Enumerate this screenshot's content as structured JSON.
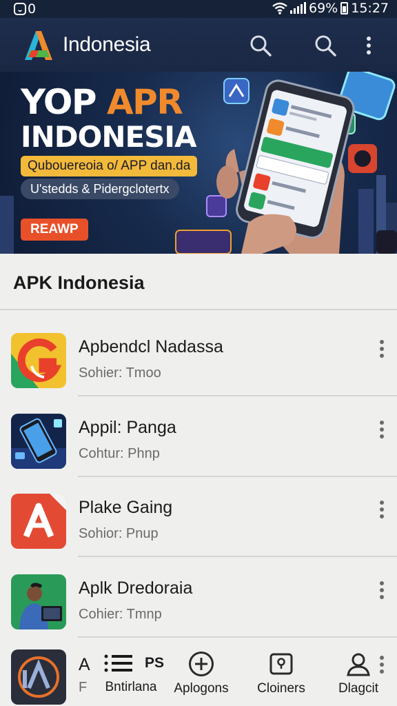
{
  "status_bar": {
    "left_text": "0",
    "battery": "69%",
    "time": "15:27"
  },
  "app_bar": {
    "title": "Indonesia"
  },
  "banner": {
    "headline_1": "YOP ",
    "headline_accent": "APR",
    "headline_2": "INDONESIA",
    "tagline": "Qubouereoia o/ APP dan.da",
    "subtitle": "U'stedds & Pidergclotertx",
    "cta": "REAWP"
  },
  "section": {
    "title": "APK Indonesia"
  },
  "apps": [
    {
      "name": "Apbendcl Nadassa",
      "subtitle": "Sohier: Tmoo",
      "icon": "green-g-phone-icon"
    },
    {
      "name": "Appil: Panga",
      "subtitle": "Cohtur: Phnp",
      "icon": "smartphone-icon"
    },
    {
      "name": "Plake Gaing",
      "subtitle": "Sohior: Pnup",
      "icon": "letter-a-icon"
    },
    {
      "name": "Aplk Dredoraia",
      "subtitle": "Cohier: Tmnp",
      "icon": "person-laptop-icon"
    },
    {
      "name": "A",
      "subtitle": "F",
      "icon": "ia-logo-icon"
    }
  ],
  "bottom_nav": [
    {
      "label": "Bntirlana",
      "extra": "PS",
      "icon": "list-icon"
    },
    {
      "label": "Aplogons",
      "icon": "add-circle-icon"
    },
    {
      "label": "Cloiners",
      "icon": "question-card-icon"
    },
    {
      "label": "Dlagcit",
      "icon": "profile-icon"
    }
  ],
  "colors": {
    "app_bar": "#1e2d4c",
    "accent_orange": "#f08a2c",
    "cta_red": "#e8502a",
    "background": "#efefee"
  }
}
